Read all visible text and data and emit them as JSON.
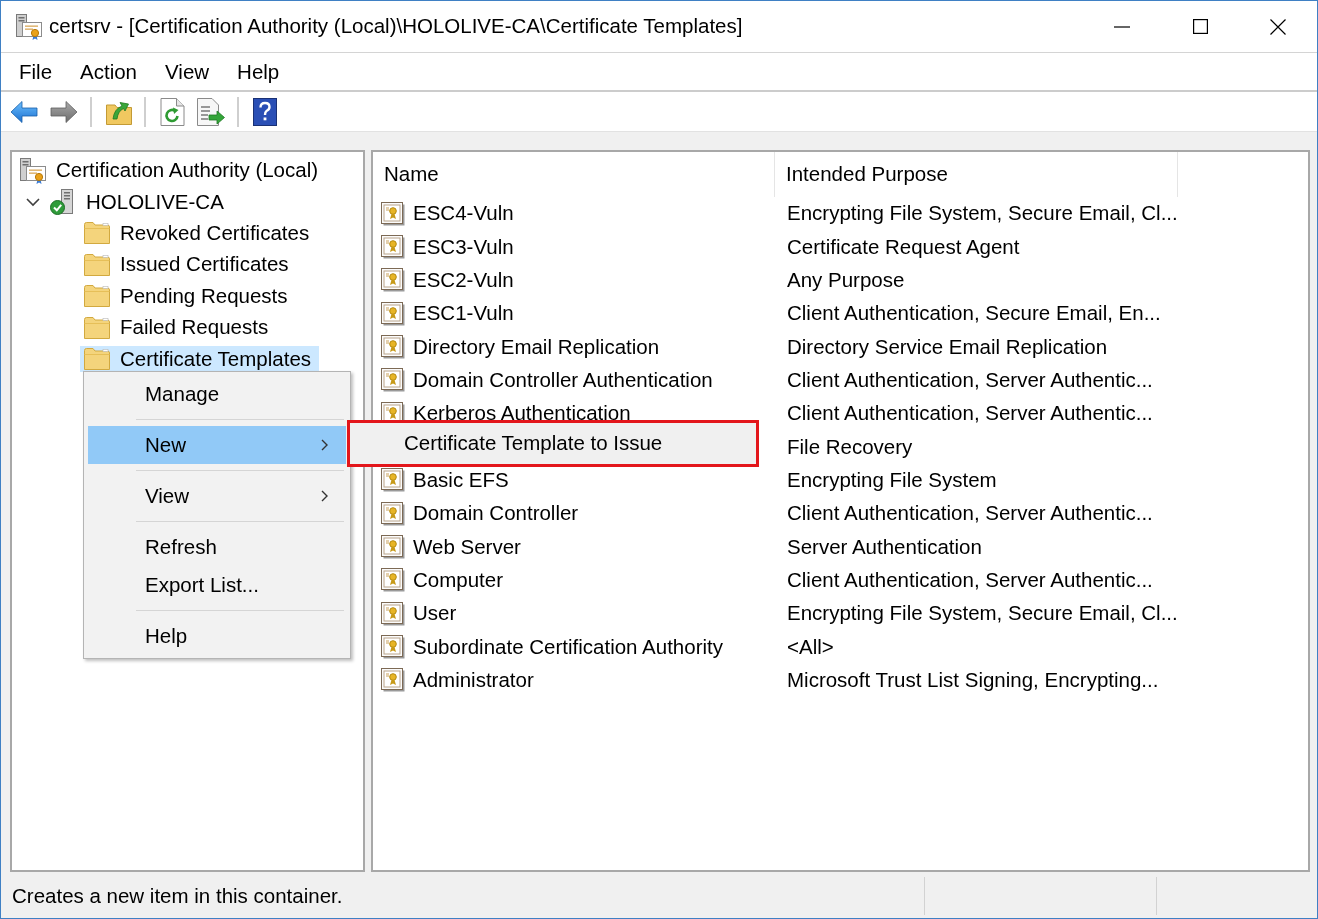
{
  "window": {
    "title": "certsrv - [Certification Authority (Local)\\HOLOLIVE-CA\\Certificate Templates]"
  },
  "menu_bar": [
    "File",
    "Action",
    "View",
    "Help"
  ],
  "toolbar": {
    "groups": [
      {
        "items": [
          {
            "kind": "back",
            "disabled": false
          },
          {
            "kind": "forward",
            "disabled": true
          }
        ]
      },
      {
        "items": [
          {
            "kind": "up",
            "disabled": false
          }
        ]
      },
      {
        "items": [
          {
            "kind": "refresh",
            "disabled": false
          },
          {
            "kind": "export",
            "disabled": false
          }
        ]
      },
      {
        "items": [
          {
            "kind": "help",
            "disabled": false
          }
        ]
      }
    ]
  },
  "tree": {
    "items": [
      {
        "label": "Certification Authority (Local)",
        "kind": "snapin",
        "selected": false,
        "children": [
          {
            "label": "HOLOLIVE-CA",
            "kind": "server",
            "selected": false,
            "expanded": true,
            "children": [
              {
                "label": "Revoked Certificates",
                "kind": "folder",
                "selected": false
              },
              {
                "label": "Issued Certificates",
                "kind": "folder",
                "selected": false
              },
              {
                "label": "Pending Requests",
                "kind": "folder",
                "selected": false
              },
              {
                "label": "Failed Requests",
                "kind": "folder",
                "selected": false
              },
              {
                "label": "Certificate Templates",
                "kind": "folder",
                "selected": true
              }
            ]
          }
        ]
      }
    ]
  },
  "list_view": {
    "columns": [
      "Name",
      "Intended Purpose"
    ],
    "rows": [
      {
        "name": "ESC4-Vuln",
        "intended_purpose": "Encrypting File System, Secure Email, Cl..."
      },
      {
        "name": "ESC3-Vuln",
        "intended_purpose": "Certificate Request Agent"
      },
      {
        "name": "ESC2-Vuln",
        "intended_purpose": "Any Purpose"
      },
      {
        "name": "ESC1-Vuln",
        "intended_purpose": "Client Authentication, Secure Email, En..."
      },
      {
        "name": "Directory Email Replication",
        "intended_purpose": "Directory Service Email Replication"
      },
      {
        "name": "Domain Controller Authentication",
        "intended_purpose": "Client Authentication, Server Authentic..."
      },
      {
        "name": "Kerberos Authentication",
        "intended_purpose": "Client Authentication, Server Authentic..."
      },
      {
        "intended_purpose": "File Recovery"
      },
      {
        "name": "Basic EFS",
        "intended_purpose": "Encrypting File System"
      },
      {
        "name": "Domain Controller",
        "intended_purpose": "Client Authentication, Server Authentic..."
      },
      {
        "name": "Web Server",
        "intended_purpose": "Server Authentication"
      },
      {
        "name": "Computer",
        "intended_purpose": "Client Authentication, Server Authentic..."
      },
      {
        "name": "User",
        "intended_purpose": "Encrypting File System, Secure Email, Cl..."
      },
      {
        "name": "Subordinate Certification Authority",
        "intended_purpose": "<All>"
      },
      {
        "name": "Administrator",
        "intended_purpose": "Microsoft Trust List Signing, Encrypting..."
      }
    ]
  },
  "context_menu": {
    "groups": [
      {
        "items": [
          {
            "label": "Manage",
            "selected": false,
            "has_submenu": false
          }
        ]
      },
      {
        "items": [
          {
            "label": "New",
            "selected": true,
            "has_submenu": true
          }
        ]
      },
      {
        "items": [
          {
            "label": "View",
            "selected": false,
            "has_submenu": true
          }
        ]
      },
      {
        "items": [
          {
            "label": "Refresh",
            "selected": false,
            "has_submenu": false
          },
          {
            "label": "Export List...",
            "selected": false,
            "has_submenu": false
          }
        ]
      },
      {
        "items": [
          {
            "label": "Help",
            "selected": false,
            "has_submenu": false
          }
        ]
      }
    ]
  },
  "submenu": {
    "outlined": true,
    "items": [
      {
        "label": "Certificate Template to Issue",
        "selected": false
      }
    ]
  },
  "status_bar": {
    "text": "Creates a new item in this container."
  }
}
